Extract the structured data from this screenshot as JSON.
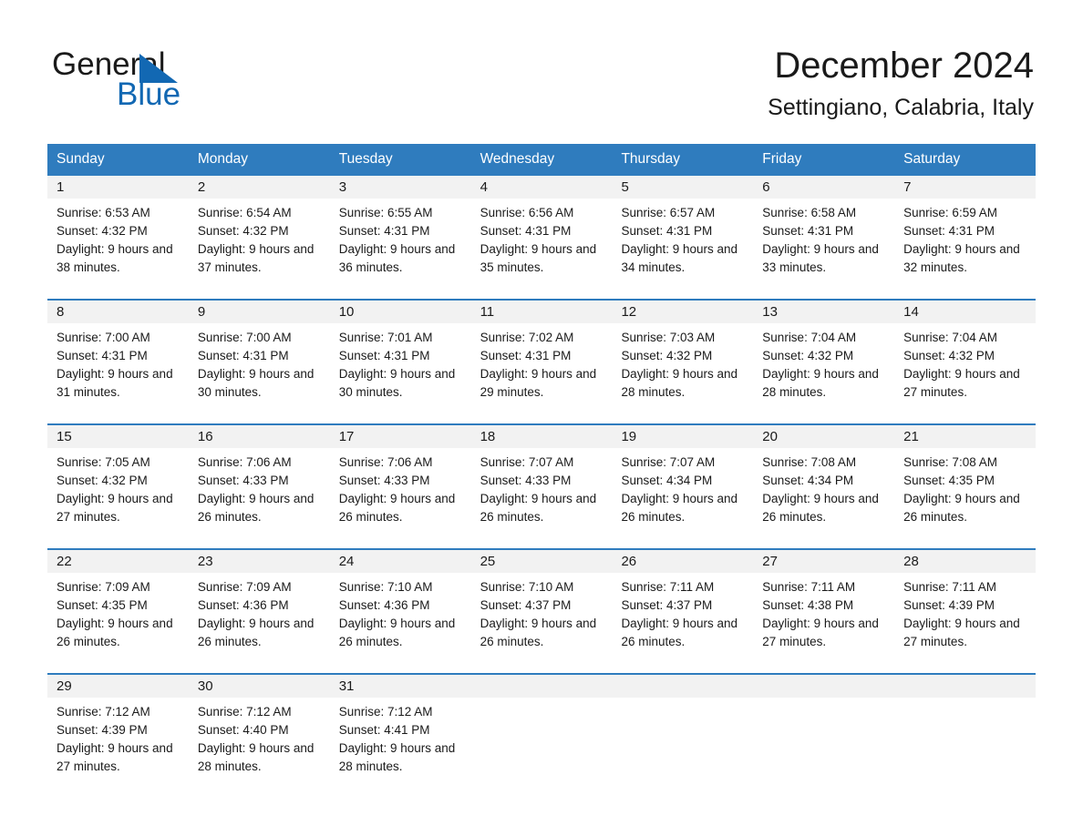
{
  "brand": {
    "logo_text_1": "General",
    "logo_text_2": "Blue",
    "accent_color": "#1268b3",
    "header_color": "#2f7cbe",
    "daynum_band_color": "#f2f2f2"
  },
  "header": {
    "title": "December 2024",
    "subtitle": "Settingiano, Calabria, Italy"
  },
  "weekdays": [
    "Sunday",
    "Monday",
    "Tuesday",
    "Wednesday",
    "Thursday",
    "Friday",
    "Saturday"
  ],
  "weeks": [
    [
      {
        "day": "1",
        "sunrise": "Sunrise: 6:53 AM",
        "sunset": "Sunset: 4:32 PM",
        "daylight": "Daylight: 9 hours and 38 minutes."
      },
      {
        "day": "2",
        "sunrise": "Sunrise: 6:54 AM",
        "sunset": "Sunset: 4:32 PM",
        "daylight": "Daylight: 9 hours and 37 minutes."
      },
      {
        "day": "3",
        "sunrise": "Sunrise: 6:55 AM",
        "sunset": "Sunset: 4:31 PM",
        "daylight": "Daylight: 9 hours and 36 minutes."
      },
      {
        "day": "4",
        "sunrise": "Sunrise: 6:56 AM",
        "sunset": "Sunset: 4:31 PM",
        "daylight": "Daylight: 9 hours and 35 minutes."
      },
      {
        "day": "5",
        "sunrise": "Sunrise: 6:57 AM",
        "sunset": "Sunset: 4:31 PM",
        "daylight": "Daylight: 9 hours and 34 minutes."
      },
      {
        "day": "6",
        "sunrise": "Sunrise: 6:58 AM",
        "sunset": "Sunset: 4:31 PM",
        "daylight": "Daylight: 9 hours and 33 minutes."
      },
      {
        "day": "7",
        "sunrise": "Sunrise: 6:59 AM",
        "sunset": "Sunset: 4:31 PM",
        "daylight": "Daylight: 9 hours and 32 minutes."
      }
    ],
    [
      {
        "day": "8",
        "sunrise": "Sunrise: 7:00 AM",
        "sunset": "Sunset: 4:31 PM",
        "daylight": "Daylight: 9 hours and 31 minutes."
      },
      {
        "day": "9",
        "sunrise": "Sunrise: 7:00 AM",
        "sunset": "Sunset: 4:31 PM",
        "daylight": "Daylight: 9 hours and 30 minutes."
      },
      {
        "day": "10",
        "sunrise": "Sunrise: 7:01 AM",
        "sunset": "Sunset: 4:31 PM",
        "daylight": "Daylight: 9 hours and 30 minutes."
      },
      {
        "day": "11",
        "sunrise": "Sunrise: 7:02 AM",
        "sunset": "Sunset: 4:31 PM",
        "daylight": "Daylight: 9 hours and 29 minutes."
      },
      {
        "day": "12",
        "sunrise": "Sunrise: 7:03 AM",
        "sunset": "Sunset: 4:32 PM",
        "daylight": "Daylight: 9 hours and 28 minutes."
      },
      {
        "day": "13",
        "sunrise": "Sunrise: 7:04 AM",
        "sunset": "Sunset: 4:32 PM",
        "daylight": "Daylight: 9 hours and 28 minutes."
      },
      {
        "day": "14",
        "sunrise": "Sunrise: 7:04 AM",
        "sunset": "Sunset: 4:32 PM",
        "daylight": "Daylight: 9 hours and 27 minutes."
      }
    ],
    [
      {
        "day": "15",
        "sunrise": "Sunrise: 7:05 AM",
        "sunset": "Sunset: 4:32 PM",
        "daylight": "Daylight: 9 hours and 27 minutes."
      },
      {
        "day": "16",
        "sunrise": "Sunrise: 7:06 AM",
        "sunset": "Sunset: 4:33 PM",
        "daylight": "Daylight: 9 hours and 26 minutes."
      },
      {
        "day": "17",
        "sunrise": "Sunrise: 7:06 AM",
        "sunset": "Sunset: 4:33 PM",
        "daylight": "Daylight: 9 hours and 26 minutes."
      },
      {
        "day": "18",
        "sunrise": "Sunrise: 7:07 AM",
        "sunset": "Sunset: 4:33 PM",
        "daylight": "Daylight: 9 hours and 26 minutes."
      },
      {
        "day": "19",
        "sunrise": "Sunrise: 7:07 AM",
        "sunset": "Sunset: 4:34 PM",
        "daylight": "Daylight: 9 hours and 26 minutes."
      },
      {
        "day": "20",
        "sunrise": "Sunrise: 7:08 AM",
        "sunset": "Sunset: 4:34 PM",
        "daylight": "Daylight: 9 hours and 26 minutes."
      },
      {
        "day": "21",
        "sunrise": "Sunrise: 7:08 AM",
        "sunset": "Sunset: 4:35 PM",
        "daylight": "Daylight: 9 hours and 26 minutes."
      }
    ],
    [
      {
        "day": "22",
        "sunrise": "Sunrise: 7:09 AM",
        "sunset": "Sunset: 4:35 PM",
        "daylight": "Daylight: 9 hours and 26 minutes."
      },
      {
        "day": "23",
        "sunrise": "Sunrise: 7:09 AM",
        "sunset": "Sunset: 4:36 PM",
        "daylight": "Daylight: 9 hours and 26 minutes."
      },
      {
        "day": "24",
        "sunrise": "Sunrise: 7:10 AM",
        "sunset": "Sunset: 4:36 PM",
        "daylight": "Daylight: 9 hours and 26 minutes."
      },
      {
        "day": "25",
        "sunrise": "Sunrise: 7:10 AM",
        "sunset": "Sunset: 4:37 PM",
        "daylight": "Daylight: 9 hours and 26 minutes."
      },
      {
        "day": "26",
        "sunrise": "Sunrise: 7:11 AM",
        "sunset": "Sunset: 4:37 PM",
        "daylight": "Daylight: 9 hours and 26 minutes."
      },
      {
        "day": "27",
        "sunrise": "Sunrise: 7:11 AM",
        "sunset": "Sunset: 4:38 PM",
        "daylight": "Daylight: 9 hours and 27 minutes."
      },
      {
        "day": "28",
        "sunrise": "Sunrise: 7:11 AM",
        "sunset": "Sunset: 4:39 PM",
        "daylight": "Daylight: 9 hours and 27 minutes."
      }
    ],
    [
      {
        "day": "29",
        "sunrise": "Sunrise: 7:12 AM",
        "sunset": "Sunset: 4:39 PM",
        "daylight": "Daylight: 9 hours and 27 minutes."
      },
      {
        "day": "30",
        "sunrise": "Sunrise: 7:12 AM",
        "sunset": "Sunset: 4:40 PM",
        "daylight": "Daylight: 9 hours and 28 minutes."
      },
      {
        "day": "31",
        "sunrise": "Sunrise: 7:12 AM",
        "sunset": "Sunset: 4:41 PM",
        "daylight": "Daylight: 9 hours and 28 minutes."
      },
      {
        "day": "",
        "sunrise": "",
        "sunset": "",
        "daylight": ""
      },
      {
        "day": "",
        "sunrise": "",
        "sunset": "",
        "daylight": ""
      },
      {
        "day": "",
        "sunrise": "",
        "sunset": "",
        "daylight": ""
      },
      {
        "day": "",
        "sunrise": "",
        "sunset": "",
        "daylight": ""
      }
    ]
  ]
}
